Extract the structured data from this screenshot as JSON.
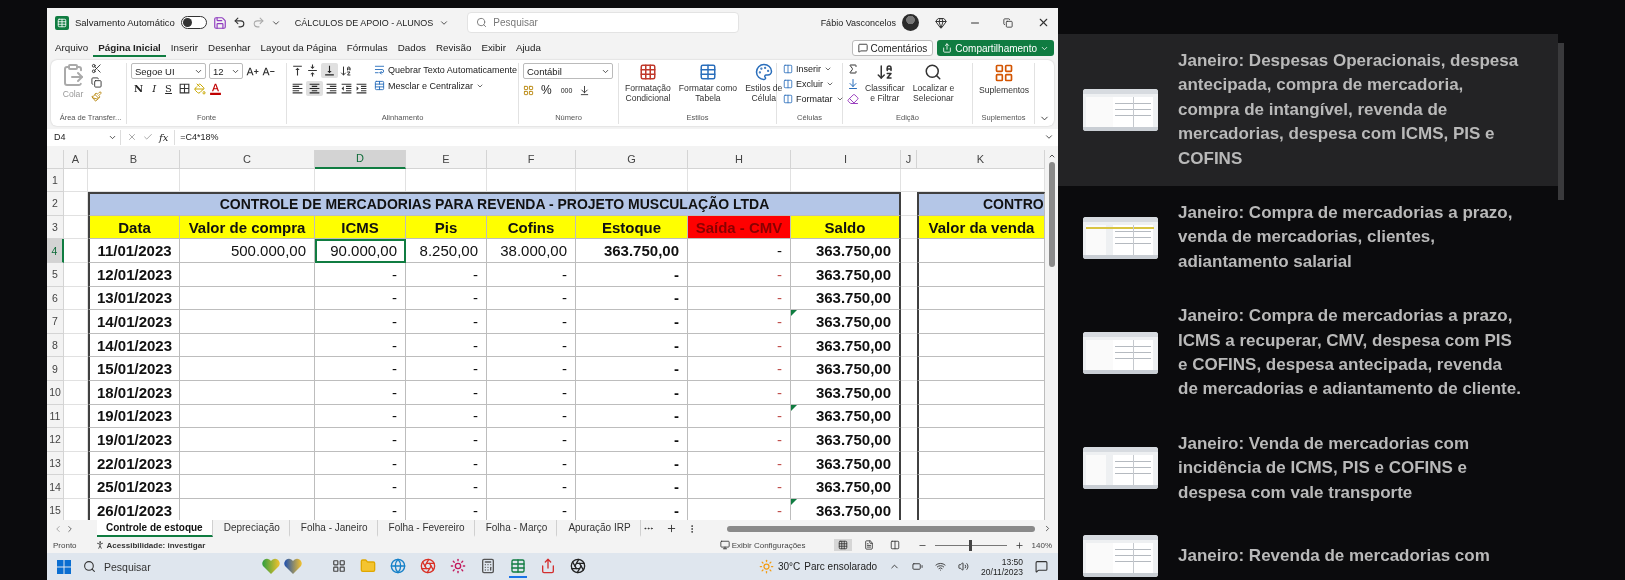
{
  "excel": {
    "title_bar": {
      "autosave_label": "Salvamento Automático",
      "autosave_on": false,
      "file_name": "CÁLCULOS DE APOIO - ALUNOS",
      "search_placeholder": "Pesquisar",
      "user_name": "Fábio Vasconcelos"
    },
    "menu_tabs": [
      {
        "label": "Arquivo",
        "selected": false
      },
      {
        "label": "Página Inicial",
        "selected": true
      },
      {
        "label": "Inserir",
        "selected": false
      },
      {
        "label": "Desenhar",
        "selected": false
      },
      {
        "label": "Layout da Página",
        "selected": false
      },
      {
        "label": "Fórmulas",
        "selected": false
      },
      {
        "label": "Dados",
        "selected": false
      },
      {
        "label": "Revisão",
        "selected": false
      },
      {
        "label": "Exibir",
        "selected": false
      },
      {
        "label": "Ajuda",
        "selected": false
      }
    ],
    "comments_button": "Comentários",
    "share_button": "Compartilhamento",
    "ribbon": {
      "clipboard": {
        "paste": "Colar",
        "label": "Área de Transfer..."
      },
      "font": {
        "font_name": "Segoe UI",
        "font_size": "12",
        "bold": "N",
        "italic": "I",
        "underline": "S",
        "label": "Fonte"
      },
      "alignment": {
        "wrap": "Quebrar Texto Automaticamente",
        "merge": "Mesclar e Centralizar",
        "label": "Alinhamento"
      },
      "number": {
        "format": "Contábil",
        "percent": "%",
        "thousands": "000",
        "label": "Número"
      },
      "styles": {
        "buttons": [
          {
            "lines": [
              "Formatação",
              "Condicional"
            ]
          },
          {
            "lines": [
              "Formatar como",
              "Tabela"
            ]
          },
          {
            "lines": [
              "Estilos de",
              "Célula"
            ]
          }
        ],
        "label": "Estilos"
      },
      "cells": {
        "buttons": [
          "Inserir",
          "Excluir",
          "Formatar"
        ],
        "label": "Células"
      },
      "editing": {
        "buttons": [
          {
            "lines": [
              "Classificar",
              "e Filtrar"
            ]
          },
          {
            "lines": [
              "Localizar e",
              "Selecionar"
            ]
          }
        ],
        "label": "Edição"
      },
      "addins": {
        "button": "Suplementos",
        "label": "Suplementos"
      }
    },
    "name_box": "D4",
    "function_label": "fx",
    "formula": "=C4*18%",
    "columns": [
      {
        "label": "A",
        "selected": false
      },
      {
        "label": "B",
        "selected": false
      },
      {
        "label": "C",
        "selected": false
      },
      {
        "label": "D",
        "selected": true
      },
      {
        "label": "E",
        "selected": false
      },
      {
        "label": "F",
        "selected": false
      },
      {
        "label": "G",
        "selected": false
      },
      {
        "label": "H",
        "selected": false
      },
      {
        "label": "I",
        "selected": false
      },
      {
        "label": "J",
        "selected": false
      },
      {
        "label": "K",
        "selected": false
      }
    ],
    "row_numbers": [
      {
        "label": "1",
        "selected": false
      },
      {
        "label": "2",
        "selected": false
      },
      {
        "label": "3",
        "selected": false
      },
      {
        "label": "4",
        "selected": true
      },
      {
        "label": "5",
        "selected": false
      },
      {
        "label": "6",
        "selected": false
      },
      {
        "label": "7",
        "selected": false
      },
      {
        "label": "8",
        "selected": false
      },
      {
        "label": "9",
        "selected": false
      },
      {
        "label": "10",
        "selected": false
      },
      {
        "label": "11",
        "selected": false
      },
      {
        "label": "12",
        "selected": false
      },
      {
        "label": "13",
        "selected": false
      },
      {
        "label": "14",
        "selected": false
      },
      {
        "label": "15",
        "selected": false
      }
    ],
    "table": {
      "title": "CONTROLE DE MERCADORIAS PARA REVENDA - PROJETO MUSCULAÇÃO LTDA",
      "headers": [
        {
          "label": "Data",
          "kind": "normal"
        },
        {
          "label": "Valor de compra",
          "kind": "normal"
        },
        {
          "label": "ICMS",
          "kind": "normal"
        },
        {
          "label": "Pis",
          "kind": "normal"
        },
        {
          "label": "Cofins",
          "kind": "normal"
        },
        {
          "label": "Estoque",
          "kind": "normal"
        },
        {
          "label": "Saída - CMV",
          "kind": "alert"
        },
        {
          "label": "Saldo",
          "kind": "normal"
        }
      ],
      "rows": [
        {
          "data": "11/01/2023",
          "valor_compra": "500.000,00",
          "icms": "90.000,00",
          "pis": "8.250,00",
          "cofins": "38.000,00",
          "estoque": "363.750,00",
          "saida_cmv": "-",
          "saldo": "363.750,00",
          "flagged": false
        },
        {
          "data": "12/01/2023",
          "icms": "-",
          "pis": "-",
          "cofins": "-",
          "estoque": "-",
          "saida_cmv": "-",
          "saldo": "363.750,00",
          "flagged": false
        },
        {
          "data": "13/01/2023",
          "icms": "-",
          "pis": "-",
          "cofins": "-",
          "estoque": "-",
          "saida_cmv": "-",
          "saldo": "363.750,00",
          "flagged": false
        },
        {
          "data": "14/01/2023",
          "icms": "-",
          "pis": "-",
          "cofins": "-",
          "estoque": "-",
          "saida_cmv": "-",
          "saldo": "363.750,00",
          "flagged": true
        },
        {
          "data": "14/01/2023",
          "icms": "-",
          "pis": "-",
          "cofins": "-",
          "estoque": "-",
          "saida_cmv": "-",
          "saldo": "363.750,00",
          "flagged": false
        },
        {
          "data": "15/01/2023",
          "icms": "-",
          "pis": "-",
          "cofins": "-",
          "estoque": "-",
          "saida_cmv": "-",
          "saldo": "363.750,00",
          "flagged": false
        },
        {
          "data": "18/01/2023",
          "icms": "-",
          "pis": "-",
          "cofins": "-",
          "estoque": "-",
          "saida_cmv": "-",
          "saldo": "363.750,00",
          "flagged": false
        },
        {
          "data": "19/01/2023",
          "icms": "-",
          "pis": "-",
          "cofins": "-",
          "estoque": "-",
          "saida_cmv": "-",
          "saldo": "363.750,00",
          "flagged": true
        },
        {
          "data": "19/01/2023",
          "icms": "-",
          "pis": "-",
          "cofins": "-",
          "estoque": "-",
          "saida_cmv": "-",
          "saldo": "363.750,00",
          "flagged": false
        },
        {
          "data": "22/01/2023",
          "icms": "-",
          "pis": "-",
          "cofins": "-",
          "estoque": "-",
          "saida_cmv": "-",
          "saldo": "363.750,00",
          "flagged": false
        },
        {
          "data": "25/01/2023",
          "icms": "-",
          "pis": "-",
          "cofins": "-",
          "estoque": "-",
          "saida_cmv": "-",
          "saldo": "363.750,00",
          "flagged": false
        },
        {
          "data": "26/01/2023",
          "icms": "-",
          "pis": "-",
          "cofins": "-",
          "estoque": "-",
          "saida_cmv": "-",
          "saldo": "363.750,00",
          "flagged": true
        }
      ]
    },
    "side_table": {
      "title": "CONTRO",
      "header": "Valor da venda"
    },
    "sheet_tabs": [
      {
        "label": "Controle de estoque",
        "selected": true
      },
      {
        "label": "Depreciação",
        "selected": false
      },
      {
        "label": "Folha - Janeiro",
        "selected": false
      },
      {
        "label": "Folha - Fevereiro",
        "selected": false
      },
      {
        "label": "Folha - Março",
        "selected": false
      },
      {
        "label": "Apuração IRP",
        "selected": false
      }
    ],
    "status_bar": {
      "ready": "Pronto",
      "accessibility": "Acessibilidade: investigar",
      "display_settings": "Exibir Configurações",
      "zoom": "140%",
      "zoom_slider": {
        "level": 0.5
      }
    }
  },
  "taskbar": {
    "search_placeholder": "Pesquisar",
    "temperature": "30°C",
    "weather": "Parc ensolarado",
    "time": "13:50",
    "date": "20/11/2023"
  },
  "playlist": [
    {
      "title": "Janeiro: Despesas Operacionais, despesa antecipada, compra de mercadoria, compra de intangível, revenda de mercadorias, despesa com ICMS, PIS e COFINS",
      "selected": true
    },
    {
      "title": "Janeiro: Compra de mercadorias a prazo, venda de mercadorias, clientes, adiantamento salarial",
      "selected": false
    },
    {
      "title": "Janeiro: Compra de mercadorias a prazo, ICMS a recuperar, CMV, despesa com PIS e COFINS, despesa antecipada, revenda de mercadorias e adiantamento de cliente.",
      "selected": false
    },
    {
      "title": "Janeiro: Venda de mercadorias com incidência de ICMS, PIS e COFINS e despesa com vale transporte",
      "selected": false
    },
    {
      "title": "Janeiro: Revenda de mercadorias com",
      "selected": false
    }
  ]
}
